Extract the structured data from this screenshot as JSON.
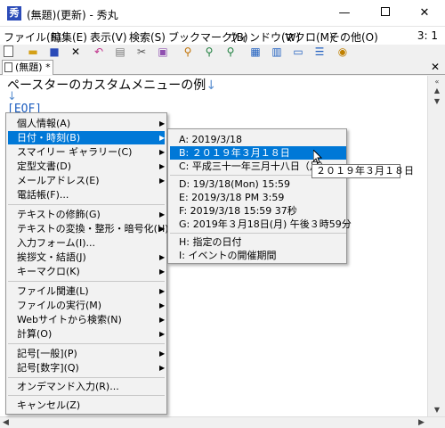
{
  "window": {
    "title": "(無題)(更新) - 秀丸",
    "minimize": "—",
    "close": "✕"
  },
  "menubar": {
    "items": [
      "ファイル(F)",
      "編集(E)",
      "表示(V)",
      "検索(S)",
      "ブックマーク(B)",
      "ウィンドウ(W)",
      "マクロ(M)",
      "その他(O)"
    ],
    "position": "3: 1"
  },
  "tab": {
    "label": "(無題) *"
  },
  "editor": {
    "line1": "ペースターのカスタムメニューの例",
    "line_return": "↓",
    "line2": "↓",
    "eof": "[EOF]"
  },
  "main_menu": {
    "items": [
      {
        "label": "個人情報(A)",
        "has_sub": true
      },
      {
        "label": "日付・時刻(B)",
        "has_sub": true,
        "selected": true
      },
      {
        "label": "スマイリー ギャラリー(C)",
        "has_sub": true
      },
      {
        "label": "定型文書(D)",
        "has_sub": true
      },
      {
        "label": "メールアドレス(E)",
        "has_sub": true
      },
      {
        "label": "電話帳(F)...",
        "has_sub": false
      },
      {
        "label": "テキストの修飾(G)",
        "has_sub": true
      },
      {
        "label": "テキストの変換・整形・暗号化(H)",
        "has_sub": true
      },
      {
        "label": "入力フォーム(I)...",
        "has_sub": false
      },
      {
        "label": "挨拶文・結語(J)",
        "has_sub": true
      },
      {
        "label": "キーマクロ(K)",
        "has_sub": true
      },
      {
        "label": "ファイル関連(L)",
        "has_sub": true
      },
      {
        "label": "ファイルの実行(M)",
        "has_sub": true
      },
      {
        "label": "Webサイトから検索(N)",
        "has_sub": true
      },
      {
        "label": "計算(O)",
        "has_sub": true
      },
      {
        "label": "記号[一般](P)",
        "has_sub": true
      },
      {
        "label": "記号[数字](Q)",
        "has_sub": true
      },
      {
        "label": "オンデマンド入力(R)...",
        "has_sub": false
      },
      {
        "label": "キャンセル(Z)",
        "has_sub": false
      }
    ]
  },
  "sub_menu": {
    "items": [
      {
        "label": "A: 2019/3/18"
      },
      {
        "label": "B: ２０１９年３月１８日",
        "selected": true
      },
      {
        "label": "C: 平成三十一年三月十八日（月）"
      },
      {
        "label": "D: 19/3/18(Mon) 15:59"
      },
      {
        "label": "E: 2019/3/18 PM 3:59"
      },
      {
        "label": "F: 2019/3/18 15:59 37秒"
      },
      {
        "label": "G: 2019年３月18日(月) 午後３時59分"
      },
      {
        "label": "H: 指定の日付"
      },
      {
        "label": "I: イベントの開催期間"
      }
    ]
  },
  "tooltip": {
    "text": "２０１９年３月１８日"
  },
  "arrow_glyph": "▶"
}
